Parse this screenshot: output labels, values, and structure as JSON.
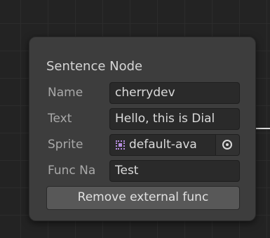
{
  "node": {
    "title": "Sentence Node",
    "fields": {
      "name_label": "Name",
      "name_value": "cherrydev",
      "text_label": "Text",
      "text_value": "Hello, this is Dial",
      "sprite_label": "Sprite",
      "sprite_value": "default-ava",
      "sprite_icon": "sprite-icon",
      "picker_icon": "object-picker-icon",
      "func_label": "Func Na",
      "func_value": "Test"
    },
    "remove_button_label": "Remove external func"
  },
  "colors": {
    "canvas_bg": "#232323",
    "node_bg": "#3d3d3d",
    "field_bg": "#2a2a2a",
    "button_bg": "#585858",
    "sprite_icon": "#b68ee0",
    "edge": "#d9d9d9"
  }
}
